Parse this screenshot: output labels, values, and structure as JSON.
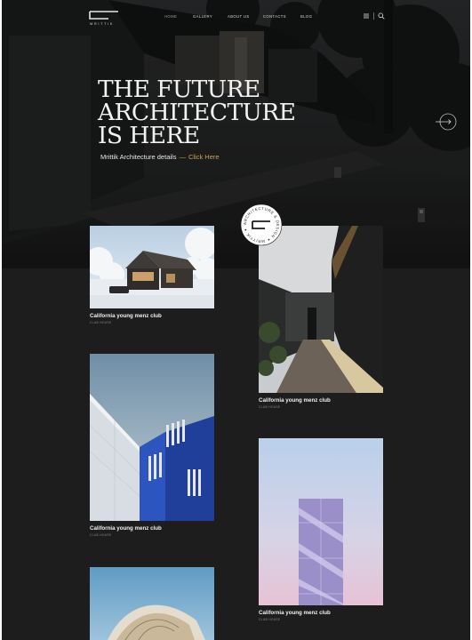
{
  "brand": {
    "logo_text": "MRITTIK"
  },
  "nav": {
    "items": [
      {
        "label": "Home",
        "active": true
      },
      {
        "label": "Gallery",
        "active": false
      },
      {
        "label": "About Us",
        "active": false
      },
      {
        "label": "Contacts",
        "active": false
      },
      {
        "label": "Blog",
        "active": false
      }
    ]
  },
  "icons": {
    "menu": "menu-icon",
    "search": "search-icon",
    "next": "arrow-right-circle-icon"
  },
  "hero": {
    "title_lines": [
      "THE FUTURE",
      "ARCHITECTURE",
      "IS HERE"
    ],
    "subtitle": "Mrittik Architecture details",
    "separator": "—",
    "link_text": "Click Here"
  },
  "badge": {
    "ring_text": "ARCHITECTURE & DESIGN ✦ MRITTIK ✦ "
  },
  "cards": [
    {
      "title": "California young menz club",
      "subtitle": "Club House"
    },
    {
      "title": "California young menz club",
      "subtitle": "Club House"
    },
    {
      "title": "California young menz club",
      "subtitle": "Club House"
    },
    {
      "title": "California young menz club",
      "subtitle": "Club House"
    },
    {
      "title": "",
      "subtitle": ""
    }
  ],
  "colors": {
    "page_bg": "#1d1d1e",
    "accent": "#c9a25a",
    "text_light": "#f0f0f0",
    "text_muted": "#8a8a8a"
  }
}
